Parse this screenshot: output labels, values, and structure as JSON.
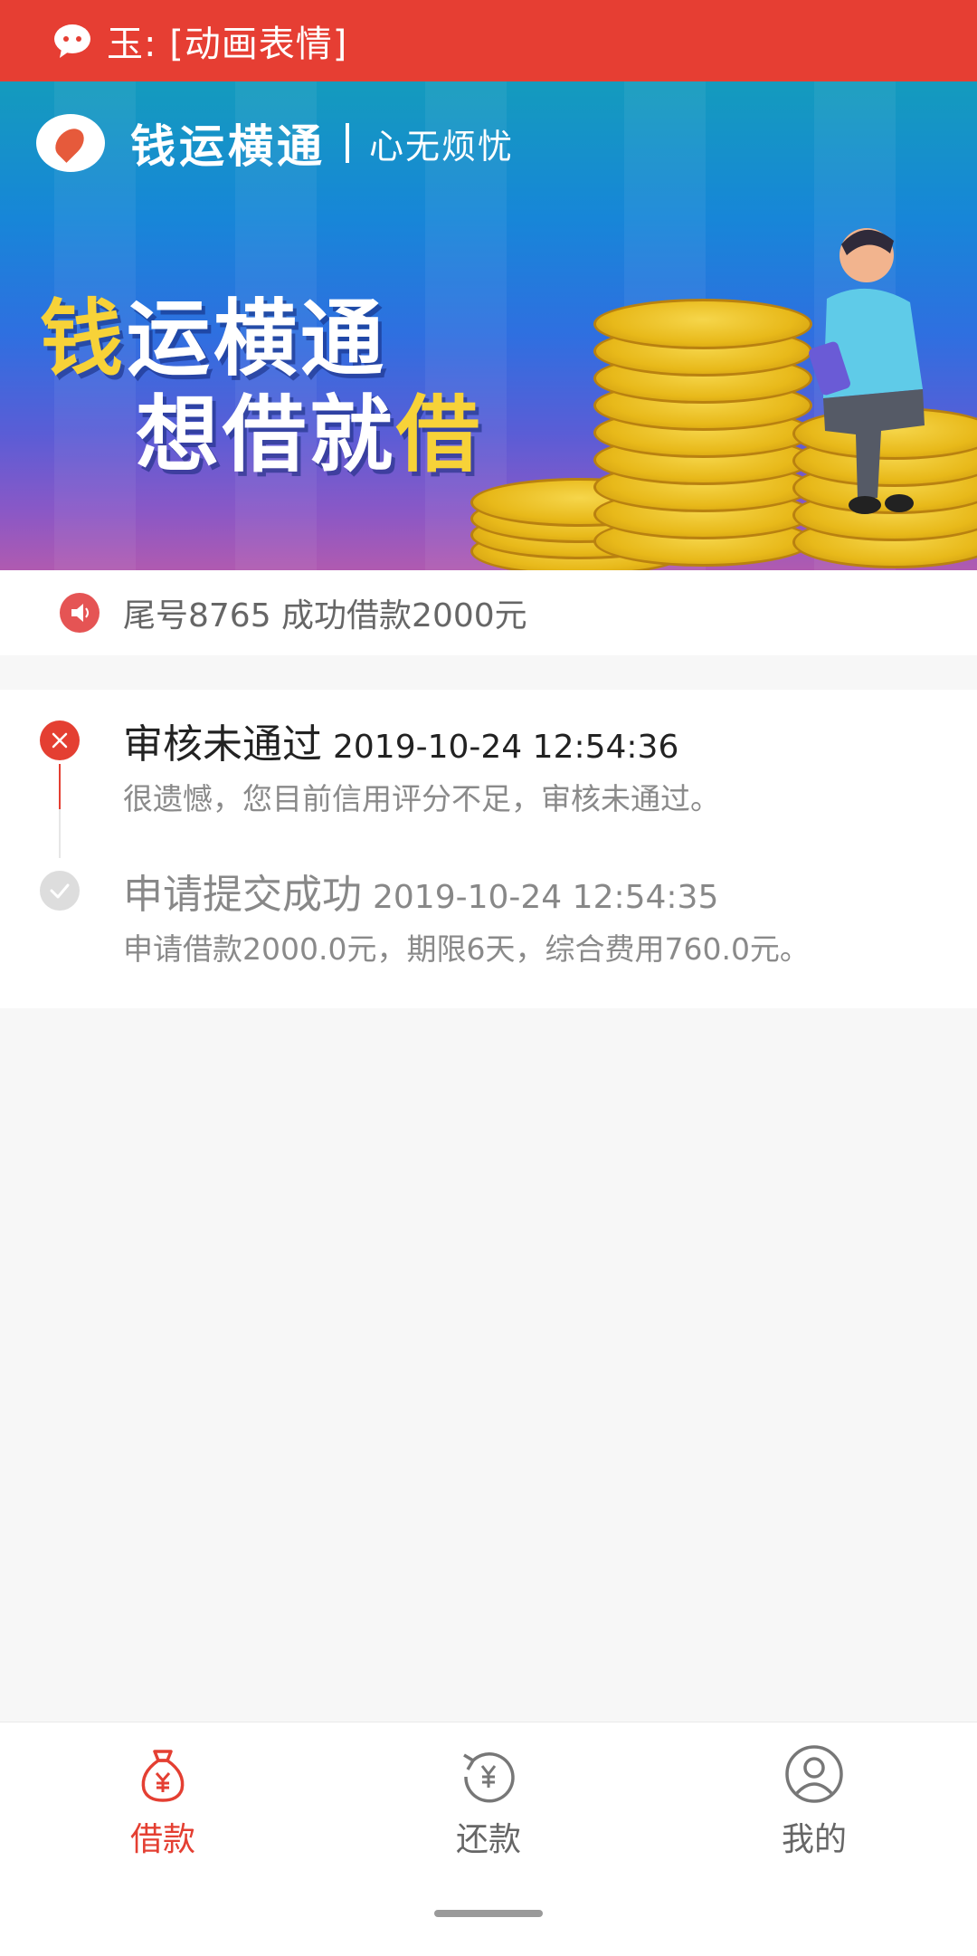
{
  "statusbar": {
    "notification_text": "玉: [动画表情]",
    "icon": "wechat-icon"
  },
  "banner": {
    "brand_name": "钱运横通",
    "slogan": "心无烦忧",
    "headline_line1_highlight": "钱",
    "headline_line1_rest": "运横通",
    "headline_line2_rest": "想借就",
    "headline_line2_highlight": "借",
    "carousel_dot_count": 1
  },
  "notice": {
    "icon": "speaker-icon",
    "text": "尾号8765 成功借款2000元"
  },
  "progress": {
    "steps": [
      {
        "status": "审核未通过",
        "time": "2019-10-24 12:54:36",
        "description": "很遗憾，您目前信用评分不足，审核未通过。",
        "icon": "close-icon",
        "state": "failed"
      },
      {
        "status": "申请提交成功",
        "time": "2019-10-24 12:54:35",
        "description": "申请借款2000.0元，期限6天，综合费用760.0元。",
        "icon": "check-icon",
        "state": "done"
      }
    ]
  },
  "tabbar": {
    "items": [
      {
        "label": "借款",
        "icon": "money-bag-icon",
        "active": true
      },
      {
        "label": "还款",
        "icon": "repay-icon",
        "active": false
      },
      {
        "label": "我的",
        "icon": "profile-icon",
        "active": false
      }
    ]
  },
  "colors": {
    "accent": "#e43f32",
    "statusbar": "#e63e33",
    "text_muted": "#8a8a8a"
  }
}
